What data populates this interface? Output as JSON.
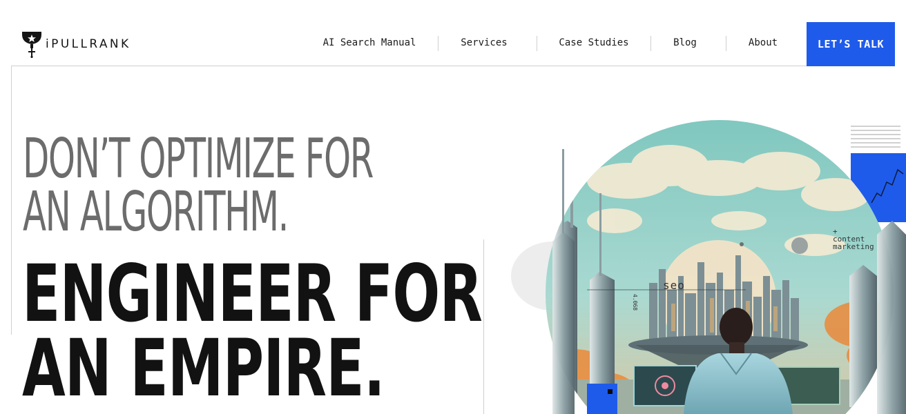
{
  "brand": {
    "name": "iPULLRANK",
    "logo_icon": "trophy-icon"
  },
  "nav": {
    "items": [
      {
        "label": "AI Search Manual"
      },
      {
        "label": "Services"
      },
      {
        "label": "Case Studies"
      },
      {
        "label": "Blog"
      },
      {
        "label": "About"
      }
    ],
    "cta_label": "LET’S TALK"
  },
  "hero": {
    "line1": "DON’T OPTIMIZE FOR",
    "line2": "AN ALGORITHM.",
    "line3": "ENGINEER FOR",
    "line4": "AN EMPIRE."
  },
  "art": {
    "caption": "+\ncontent\nmarketing",
    "seo_label": "seo",
    "vertical_label": "4.068"
  },
  "colors": {
    "accent": "#1f5bea",
    "text_dark": "#121212",
    "text_light": "#6c6c6c",
    "sky": "#8fcfc6"
  }
}
